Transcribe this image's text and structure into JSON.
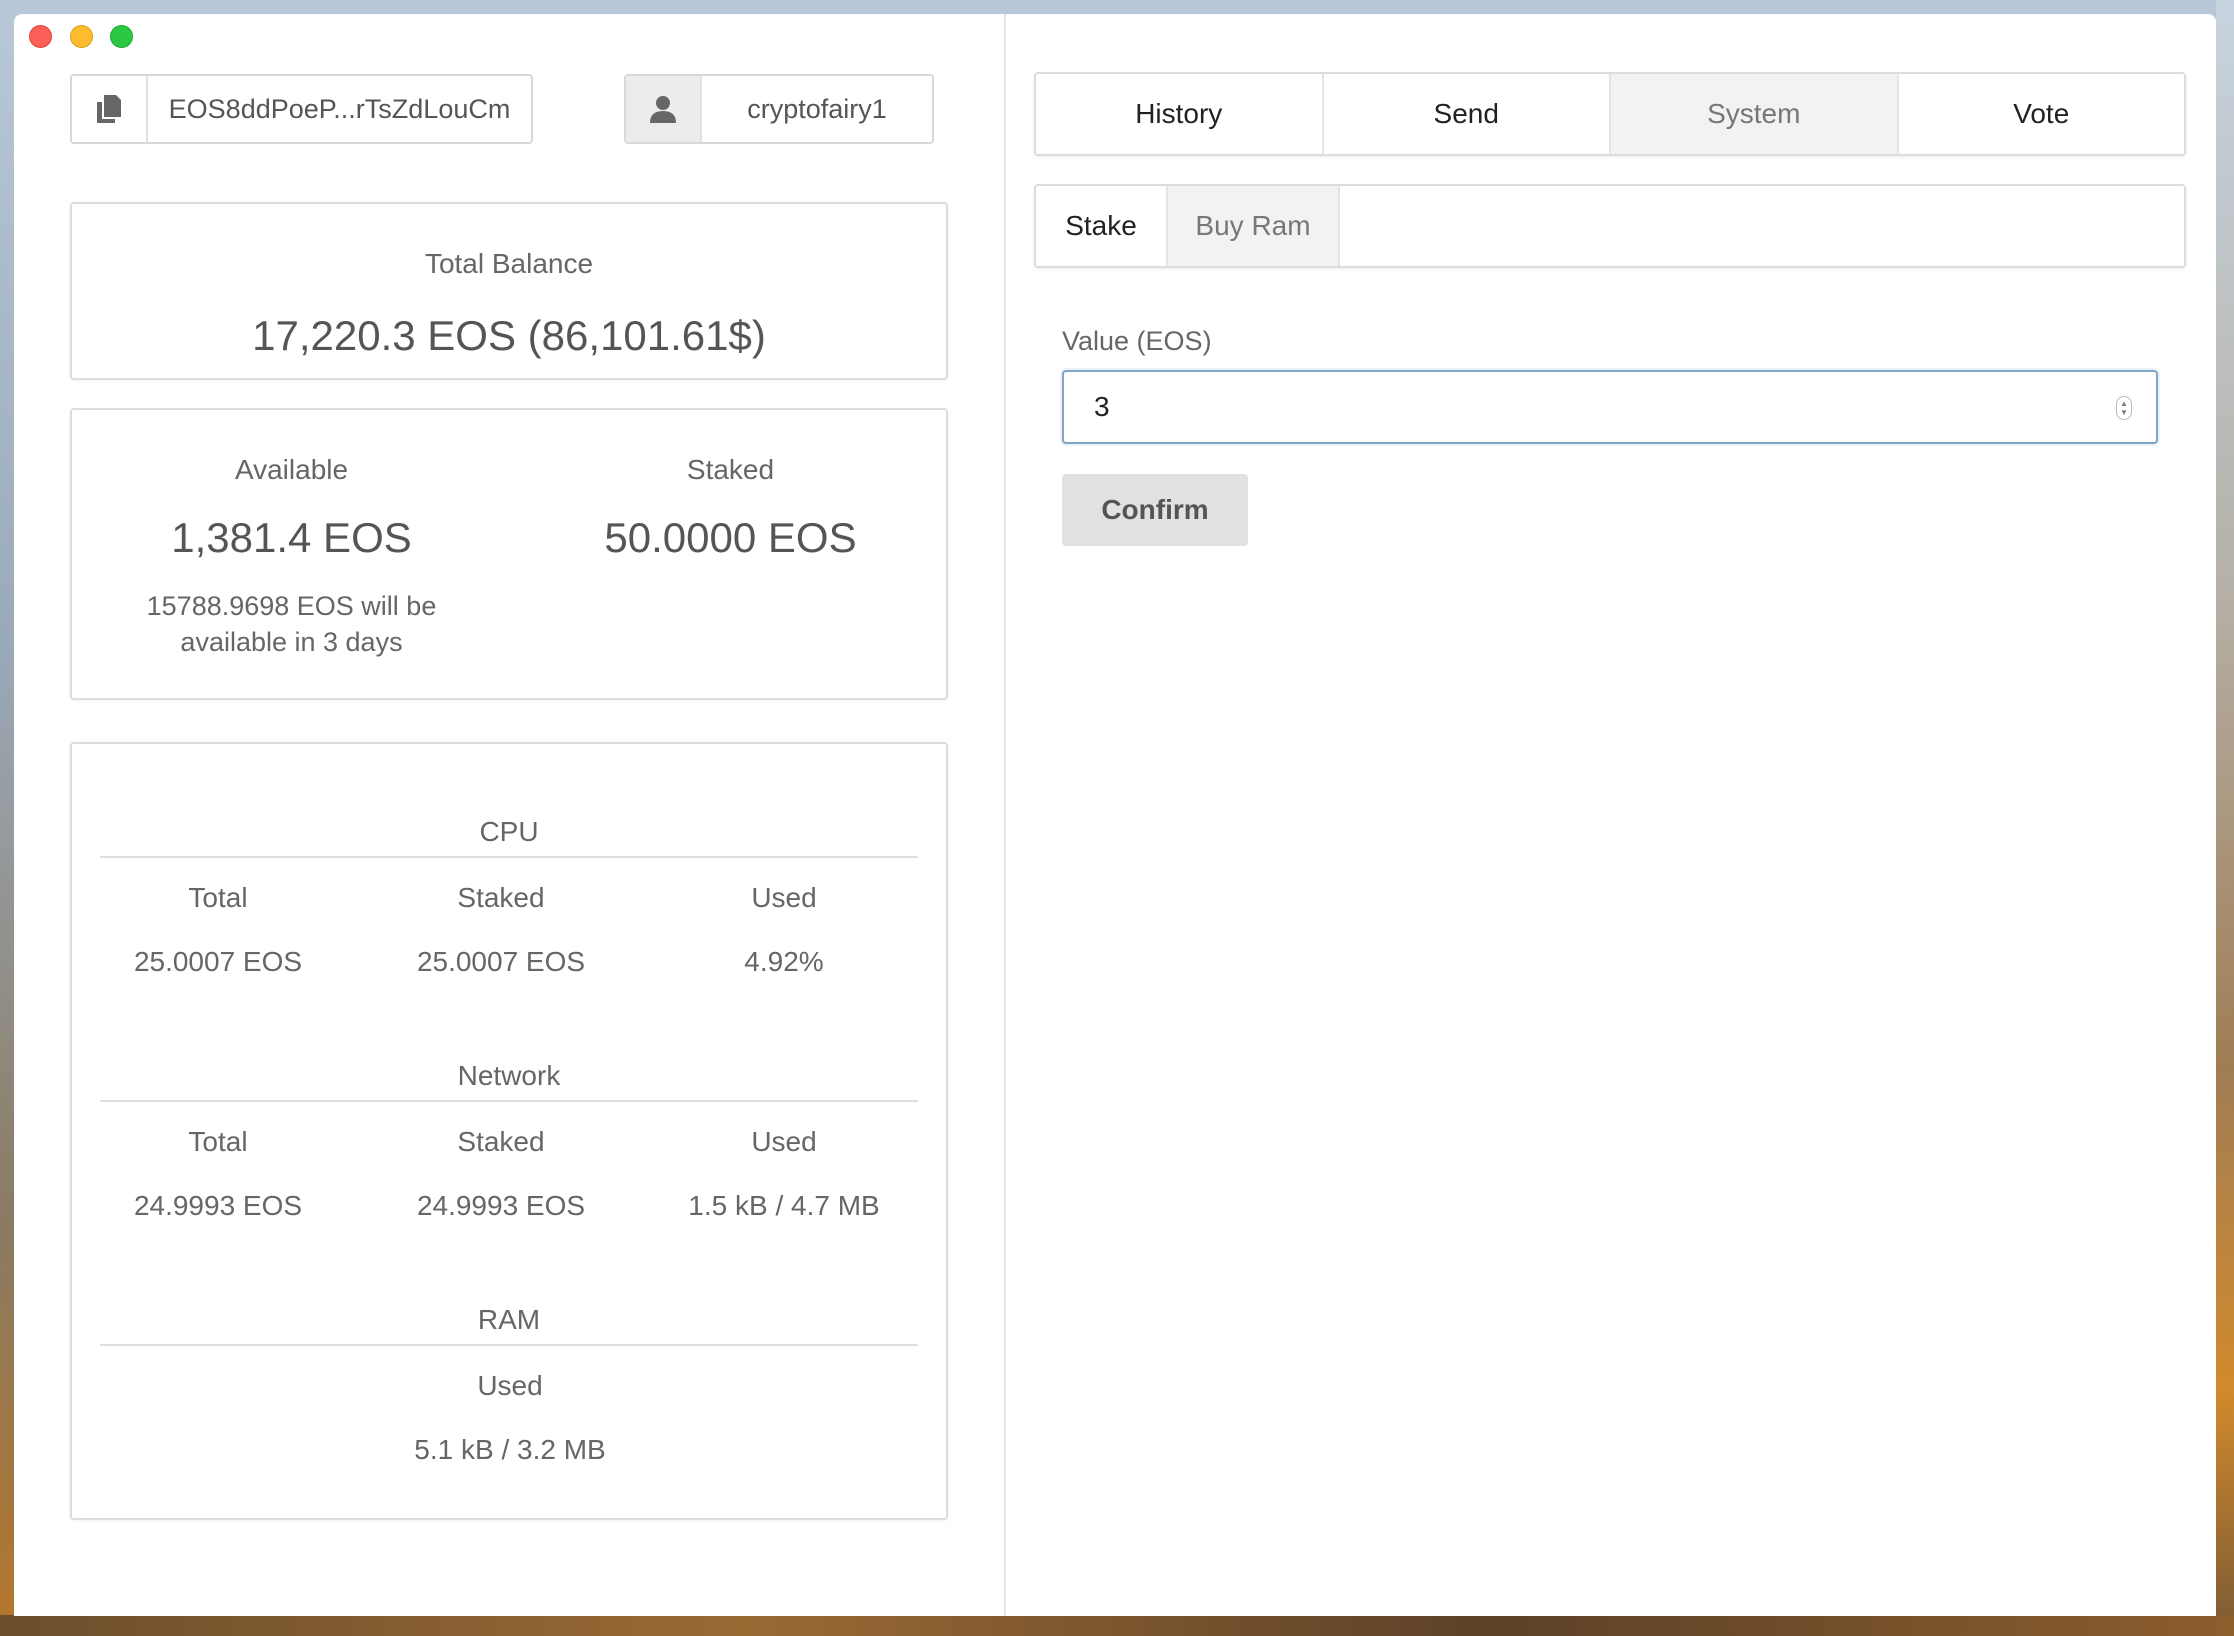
{
  "wallet": {
    "address": "EOS8ddPoeP...rTsZdLouCm",
    "account": "cryptofairy1"
  },
  "balance": {
    "label": "Total Balance",
    "value": "17,220.3 EOS (86,101.61$)"
  },
  "available": {
    "label": "Available",
    "value": "1,381.4 EOS",
    "note": "15788.9698 EOS will be available in 3 days"
  },
  "staked": {
    "label": "Staked",
    "value": "50.0000 EOS"
  },
  "resources": {
    "cpu": {
      "title": "CPU",
      "total_label": "Total",
      "staked_label": "Staked",
      "used_label": "Used",
      "total": "25.0007 EOS",
      "staked": "25.0007 EOS",
      "used": "4.92%"
    },
    "network": {
      "title": "Network",
      "total_label": "Total",
      "staked_label": "Staked",
      "used_label": "Used",
      "total": "24.9993 EOS",
      "staked": "24.9993 EOS",
      "used": "1.5 kB / 4.7 MB"
    },
    "ram": {
      "title": "RAM",
      "used_label": "Used",
      "used": "5.1 kB / 3.2 MB"
    }
  },
  "tabs": [
    "History",
    "Send",
    "System",
    "Vote"
  ],
  "active_tab": "System",
  "subtabs": [
    "Stake",
    "Buy Ram"
  ],
  "active_subtab": "Buy Ram",
  "form": {
    "value_label": "Value (EOS)",
    "value": "3",
    "confirm_label": "Confirm"
  },
  "icons": {
    "address": "copy-icon",
    "account": "user-icon"
  }
}
